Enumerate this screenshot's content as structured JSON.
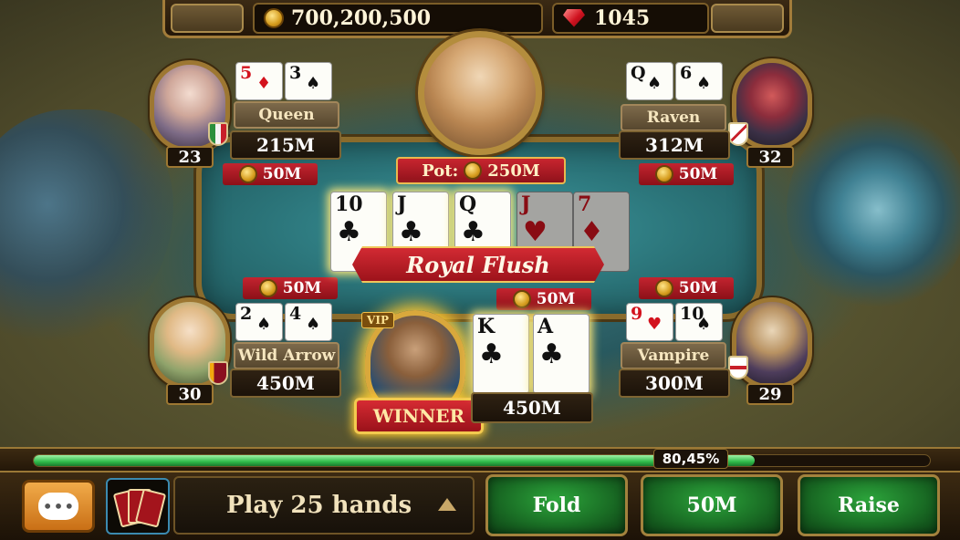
{
  "header": {
    "coins": "700,200,500",
    "gems": "1045"
  },
  "table": {
    "pot_label": "Pot:",
    "pot_value": "250M",
    "hand_result": "Royal Flush",
    "board": [
      {
        "rank": "10",
        "suit": "♣",
        "color": "black"
      },
      {
        "rank": "J",
        "suit": "♣",
        "color": "black"
      },
      {
        "rank": "Q",
        "suit": "♣",
        "color": "black"
      },
      {
        "rank": "J",
        "suit": "♥",
        "color": "red"
      },
      {
        "rank": "7",
        "suit": "♦",
        "color": "red"
      }
    ]
  },
  "players": {
    "queen": {
      "name": "Queen",
      "level": "23",
      "chips": "215M",
      "bet": "50M",
      "cards": [
        {
          "rank": "5",
          "suit": "♦",
          "color": "red"
        },
        {
          "rank": "3",
          "suit": "♠",
          "color": "black"
        }
      ]
    },
    "raven": {
      "name": "Raven",
      "level": "32",
      "chips": "312M",
      "bet": "50M",
      "cards": [
        {
          "rank": "Q",
          "suit": "♠",
          "color": "black"
        },
        {
          "rank": "6",
          "suit": "♠",
          "color": "black"
        }
      ]
    },
    "wild_arrow": {
      "name": "Wild Arrow",
      "level": "30",
      "chips": "450M",
      "bet": "50M",
      "cards": [
        {
          "rank": "2",
          "suit": "♠",
          "color": "black"
        },
        {
          "rank": "4",
          "suit": "♠",
          "color": "black"
        }
      ]
    },
    "vampire": {
      "name": "Vampire",
      "level": "29",
      "chips": "300M",
      "bet": "50M",
      "cards": [
        {
          "rank": "9",
          "suit": "♥",
          "color": "red"
        },
        {
          "rank": "10",
          "suit": "♠",
          "color": "black"
        }
      ]
    },
    "hero": {
      "vip": "VIP",
      "badge": "WINNER",
      "chips": "450M",
      "bet": "50M",
      "cards": [
        {
          "rank": "K",
          "suit": "♣",
          "color": "black"
        },
        {
          "rank": "A",
          "suit": "♣",
          "color": "black"
        }
      ]
    }
  },
  "progress": {
    "label": "80,45%",
    "fraction": 0.8045
  },
  "bottom": {
    "chat_icon": "chat-bubble-icon",
    "quest": "Play 25 hands",
    "fold": "Fold",
    "call": "50M",
    "raise": "Raise"
  },
  "colors": {
    "accent_gold": "#b48d3d",
    "banner_red": "#c32430",
    "action_green": "#2ca43b"
  }
}
